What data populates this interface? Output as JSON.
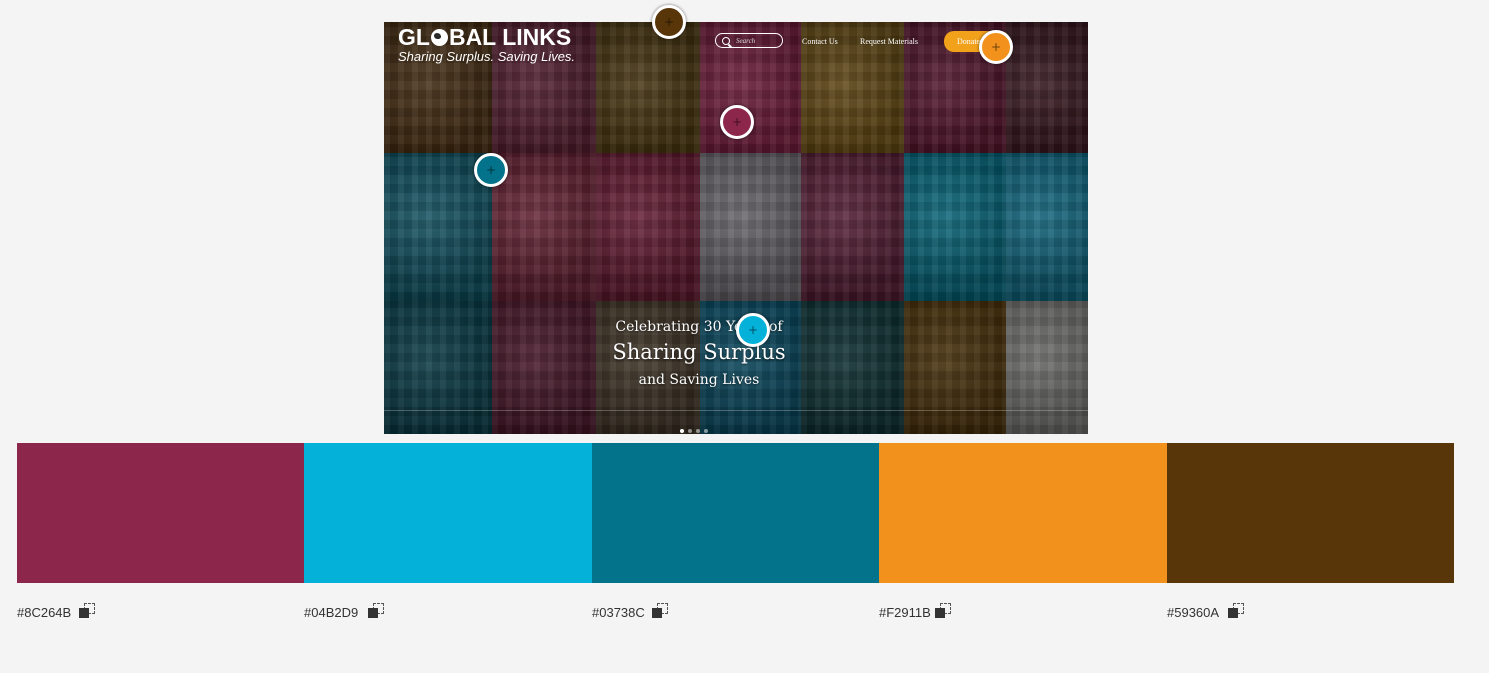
{
  "preview": {
    "logo": {
      "title_before": "GL",
      "title_after": "BAL LINKS",
      "tagline": "Sharing Surplus. Saving Lives."
    },
    "nav": {
      "search_placeholder": "Search",
      "contact": "Contact Us",
      "request": "Request Materials",
      "donate": "Donate"
    },
    "hero": {
      "line1": "Celebrating 30 Years of",
      "line2": "Sharing Surplus",
      "line3": "and Saving Lives"
    },
    "slides": [
      {
        "active": true
      },
      {
        "active": false
      },
      {
        "active": false
      },
      {
        "active": false
      }
    ]
  },
  "palette": {
    "swatches": [
      {
        "hex": "#8C264B",
        "color": "#8C264B"
      },
      {
        "hex": "#04B2D9",
        "color": "#04B2D9"
      },
      {
        "hex": "#03738C",
        "color": "#03738C"
      },
      {
        "hex": "#F2911B",
        "color": "#F2911B"
      },
      {
        "hex": "#59360A",
        "color": "#59360A"
      }
    ]
  },
  "pickers": [
    {
      "color": "#59360A",
      "symbol": "+"
    },
    {
      "color": "#F2911B",
      "symbol": "+"
    },
    {
      "color": "#8C264B",
      "symbol": "+"
    },
    {
      "color": "#03738C",
      "symbol": "+"
    },
    {
      "color": "#04B2D9",
      "symbol": "+"
    }
  ]
}
